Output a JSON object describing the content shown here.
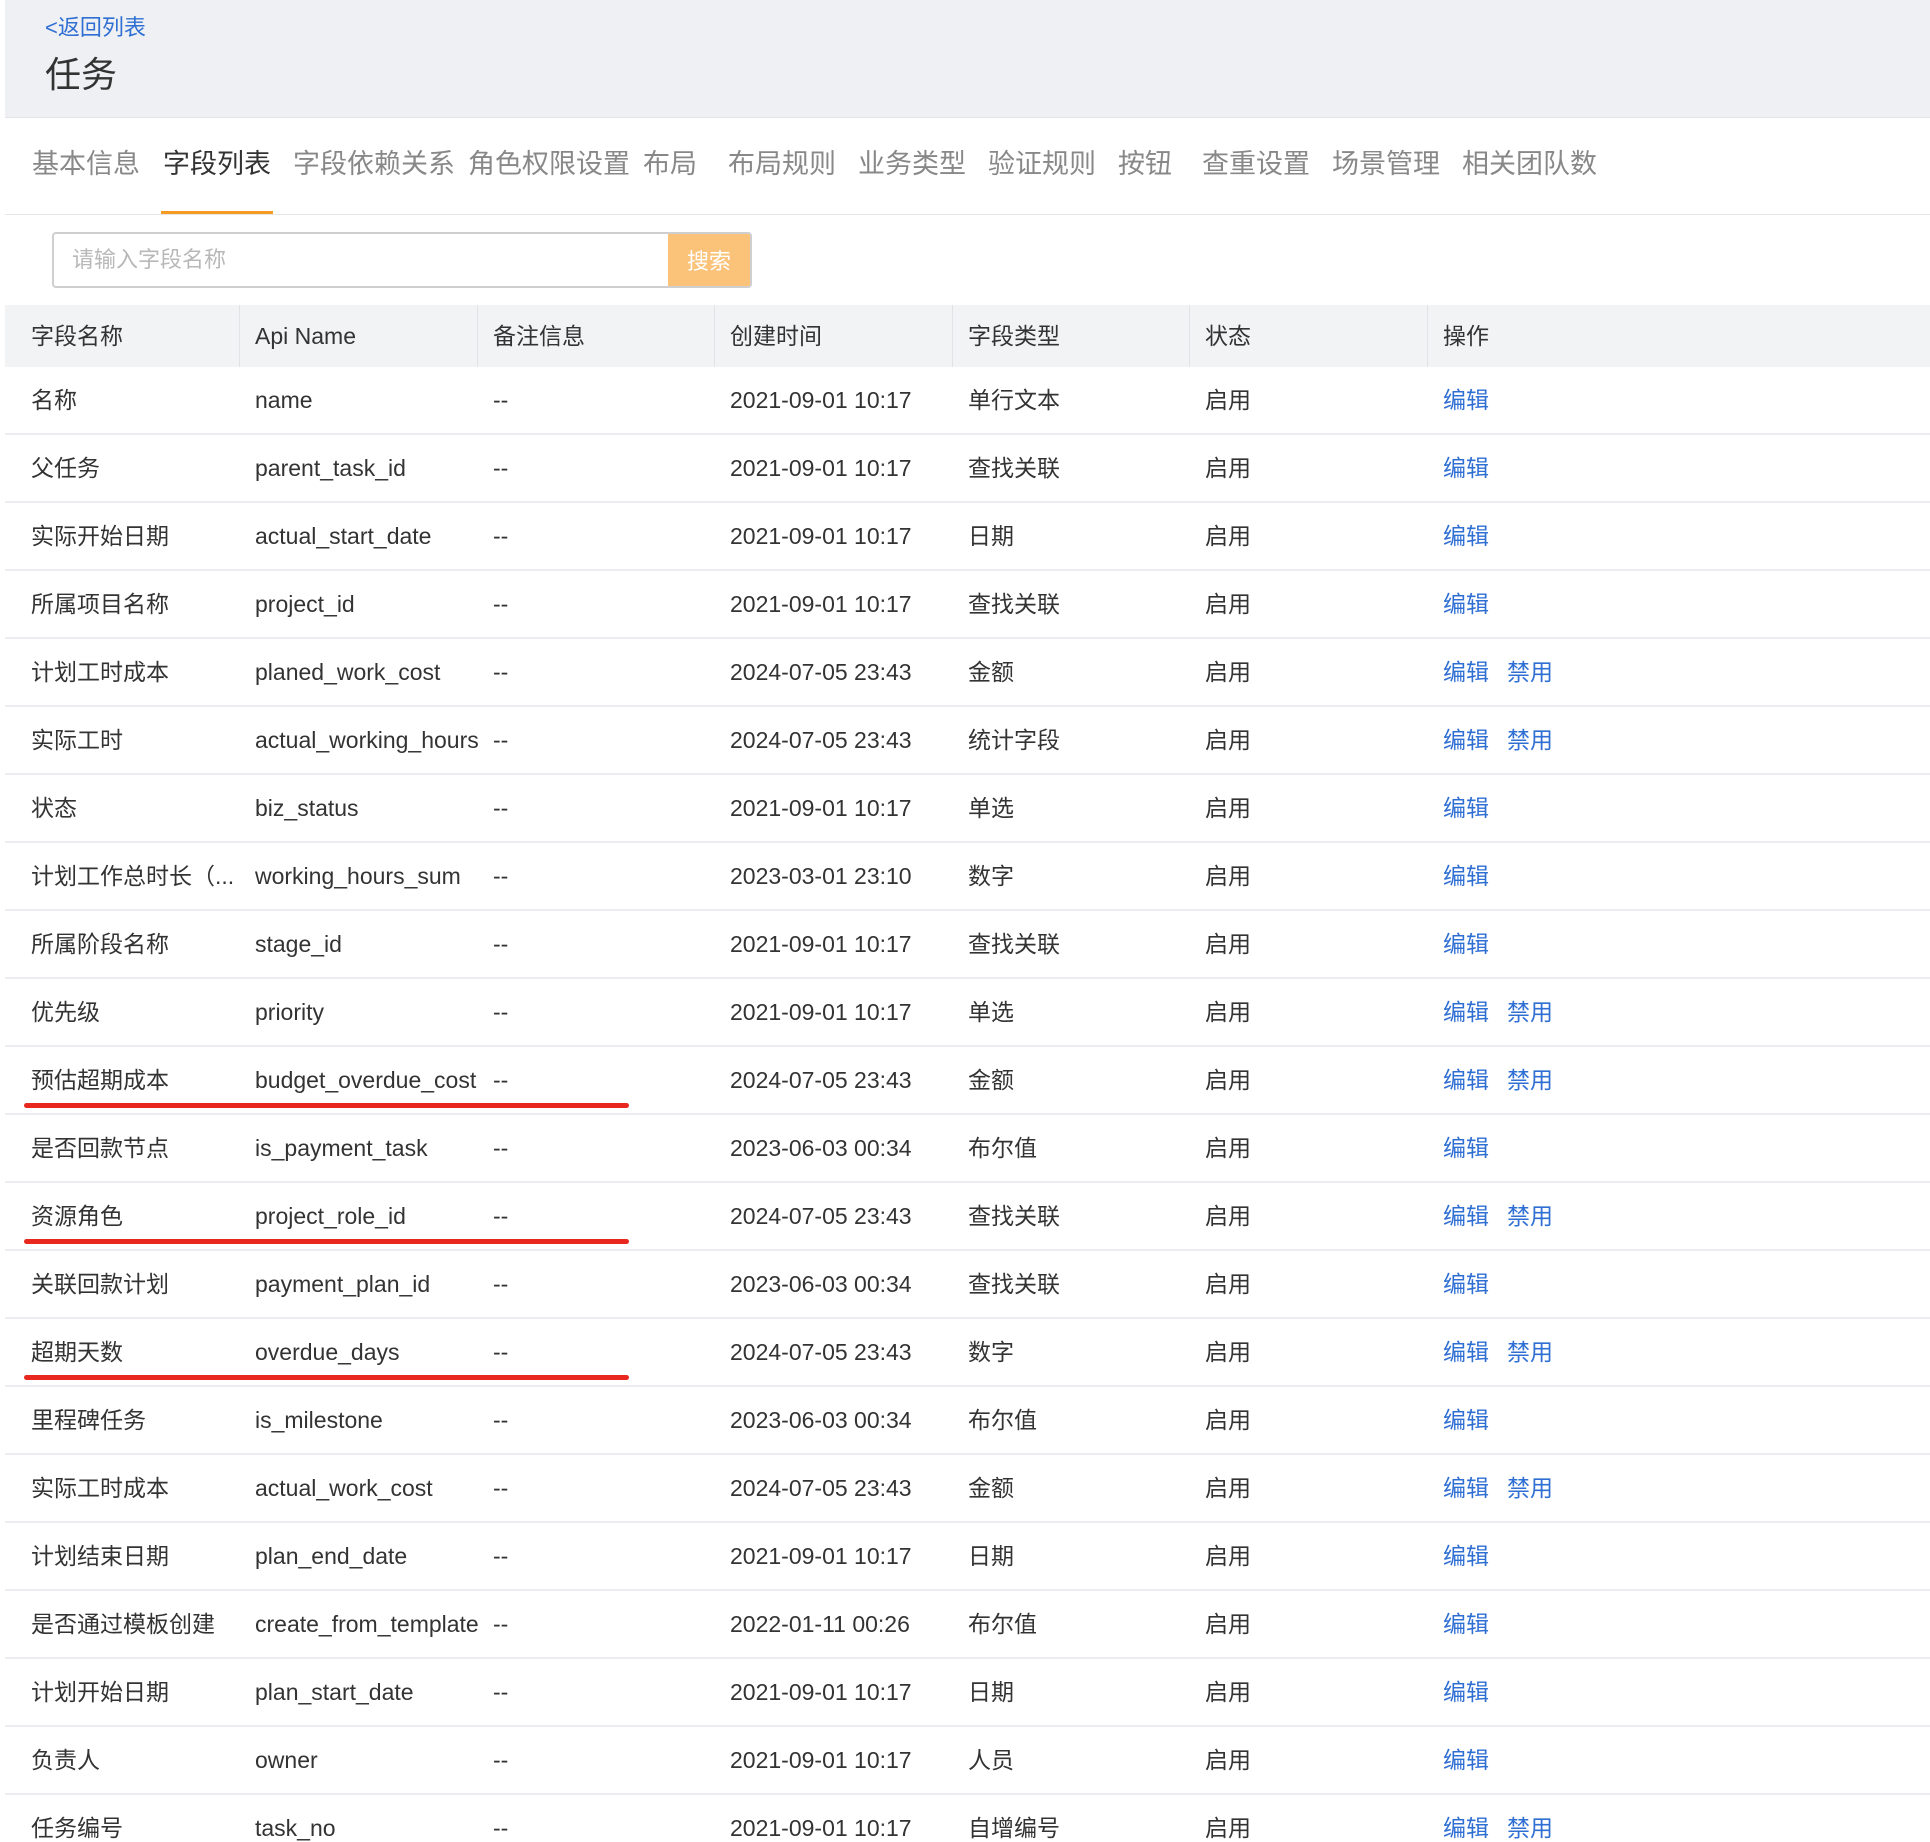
{
  "header": {
    "back_label": "<返回列表",
    "title": "任务"
  },
  "tabs": [
    {
      "label": "基本信息",
      "active": false
    },
    {
      "label": "字段列表",
      "active": true
    },
    {
      "label": "字段依赖关系",
      "active": false
    },
    {
      "label": "角色权限设置",
      "active": false
    },
    {
      "label": "布局",
      "active": false
    },
    {
      "label": "布局规则",
      "active": false
    },
    {
      "label": "业务类型",
      "active": false
    },
    {
      "label": "验证规则",
      "active": false
    },
    {
      "label": "按钮",
      "active": false
    },
    {
      "label": "查重设置",
      "active": false
    },
    {
      "label": "场景管理",
      "active": false
    },
    {
      "label": "相关团队数",
      "active": false
    }
  ],
  "search": {
    "placeholder": "请输入字段名称",
    "value": "",
    "button_label": "搜索"
  },
  "table": {
    "columns": [
      "字段名称",
      "Api Name",
      "备注信息",
      "创建时间",
      "字段类型",
      "状态",
      "操作"
    ],
    "rows": [
      {
        "name": "名称",
        "api": "name",
        "remark": "--",
        "created": "2021-09-01 10:17",
        "type": "单行文本",
        "status": "启用",
        "actions": [
          "编辑"
        ],
        "highlighted": false
      },
      {
        "name": "父任务",
        "api": "parent_task_id",
        "remark": "--",
        "created": "2021-09-01 10:17",
        "type": "查找关联",
        "status": "启用",
        "actions": [
          "编辑"
        ],
        "highlighted": false
      },
      {
        "name": "实际开始日期",
        "api": "actual_start_date",
        "remark": "--",
        "created": "2021-09-01 10:17",
        "type": "日期",
        "status": "启用",
        "actions": [
          "编辑"
        ],
        "highlighted": false
      },
      {
        "name": "所属项目名称",
        "api": "project_id",
        "remark": "--",
        "created": "2021-09-01 10:17",
        "type": "查找关联",
        "status": "启用",
        "actions": [
          "编辑"
        ],
        "highlighted": false
      },
      {
        "name": "计划工时成本",
        "api": "planed_work_cost",
        "remark": "--",
        "created": "2024-07-05 23:43",
        "type": "金额",
        "status": "启用",
        "actions": [
          "编辑",
          "禁用"
        ],
        "highlighted": false
      },
      {
        "name": "实际工时",
        "api": "actual_working_hours",
        "remark": "--",
        "created": "2024-07-05 23:43",
        "type": "统计字段",
        "status": "启用",
        "actions": [
          "编辑",
          "禁用"
        ],
        "highlighted": false
      },
      {
        "name": "状态",
        "api": "biz_status",
        "remark": "--",
        "created": "2021-09-01 10:17",
        "type": "单选",
        "status": "启用",
        "actions": [
          "编辑"
        ],
        "highlighted": false
      },
      {
        "name": "计划工作总时长（...",
        "api": "working_hours_sum",
        "remark": "--",
        "created": "2023-03-01 23:10",
        "type": "数字",
        "status": "启用",
        "actions": [
          "编辑"
        ],
        "highlighted": false
      },
      {
        "name": "所属阶段名称",
        "api": "stage_id",
        "remark": "--",
        "created": "2021-09-01 10:17",
        "type": "查找关联",
        "status": "启用",
        "actions": [
          "编辑"
        ],
        "highlighted": false
      },
      {
        "name": "优先级",
        "api": "priority",
        "remark": "--",
        "created": "2021-09-01 10:17",
        "type": "单选",
        "status": "启用",
        "actions": [
          "编辑",
          "禁用"
        ],
        "highlighted": false
      },
      {
        "name": "预估超期成本",
        "api": "budget_overdue_cost",
        "remark": "--",
        "created": "2024-07-05 23:43",
        "type": "金额",
        "status": "启用",
        "actions": [
          "编辑",
          "禁用"
        ],
        "highlighted": true
      },
      {
        "name": "是否回款节点",
        "api": "is_payment_task",
        "remark": "--",
        "created": "2023-06-03 00:34",
        "type": "布尔值",
        "status": "启用",
        "actions": [
          "编辑"
        ],
        "highlighted": false
      },
      {
        "name": "资源角色",
        "api": "project_role_id",
        "remark": "--",
        "created": "2024-07-05 23:43",
        "type": "查找关联",
        "status": "启用",
        "actions": [
          "编辑",
          "禁用"
        ],
        "highlighted": true
      },
      {
        "name": "关联回款计划",
        "api": "payment_plan_id",
        "remark": "--",
        "created": "2023-06-03 00:34",
        "type": "查找关联",
        "status": "启用",
        "actions": [
          "编辑"
        ],
        "highlighted": false
      },
      {
        "name": "超期天数",
        "api": "overdue_days",
        "remark": "--",
        "created": "2024-07-05 23:43",
        "type": "数字",
        "status": "启用",
        "actions": [
          "编辑",
          "禁用"
        ],
        "highlighted": true
      },
      {
        "name": "里程碑任务",
        "api": "is_milestone",
        "remark": "--",
        "created": "2023-06-03 00:34",
        "type": "布尔值",
        "status": "启用",
        "actions": [
          "编辑"
        ],
        "highlighted": false
      },
      {
        "name": "实际工时成本",
        "api": "actual_work_cost",
        "remark": "--",
        "created": "2024-07-05 23:43",
        "type": "金额",
        "status": "启用",
        "actions": [
          "编辑",
          "禁用"
        ],
        "highlighted": false
      },
      {
        "name": "计划结束日期",
        "api": "plan_end_date",
        "remark": "--",
        "created": "2021-09-01 10:17",
        "type": "日期",
        "status": "启用",
        "actions": [
          "编辑"
        ],
        "highlighted": false
      },
      {
        "name": "是否通过模板创建",
        "api": "create_from_template",
        "remark": "--",
        "created": "2022-01-11 00:26",
        "type": "布尔值",
        "status": "启用",
        "actions": [
          "编辑"
        ],
        "highlighted": false
      },
      {
        "name": "计划开始日期",
        "api": "plan_start_date",
        "remark": "--",
        "created": "2021-09-01 10:17",
        "type": "日期",
        "status": "启用",
        "actions": [
          "编辑"
        ],
        "highlighted": false
      },
      {
        "name": "负责人",
        "api": "owner",
        "remark": "--",
        "created": "2021-09-01 10:17",
        "type": "人员",
        "status": "启用",
        "actions": [
          "编辑"
        ],
        "highlighted": false
      },
      {
        "name": "任务编号",
        "api": "task_no",
        "remark": "--",
        "created": "2021-09-01 10:17",
        "type": "自增编号",
        "status": "启用",
        "actions": [
          "编辑",
          "禁用"
        ],
        "highlighted": false
      }
    ]
  },
  "colors": {
    "link": "#2f6fd3",
    "tab_accent": "#f59a23",
    "search_button": "#fbc37a",
    "highlight_marker": "#e8281e",
    "header_bg": "#eef0f3",
    "table_header_bg": "#f2f3f5"
  }
}
